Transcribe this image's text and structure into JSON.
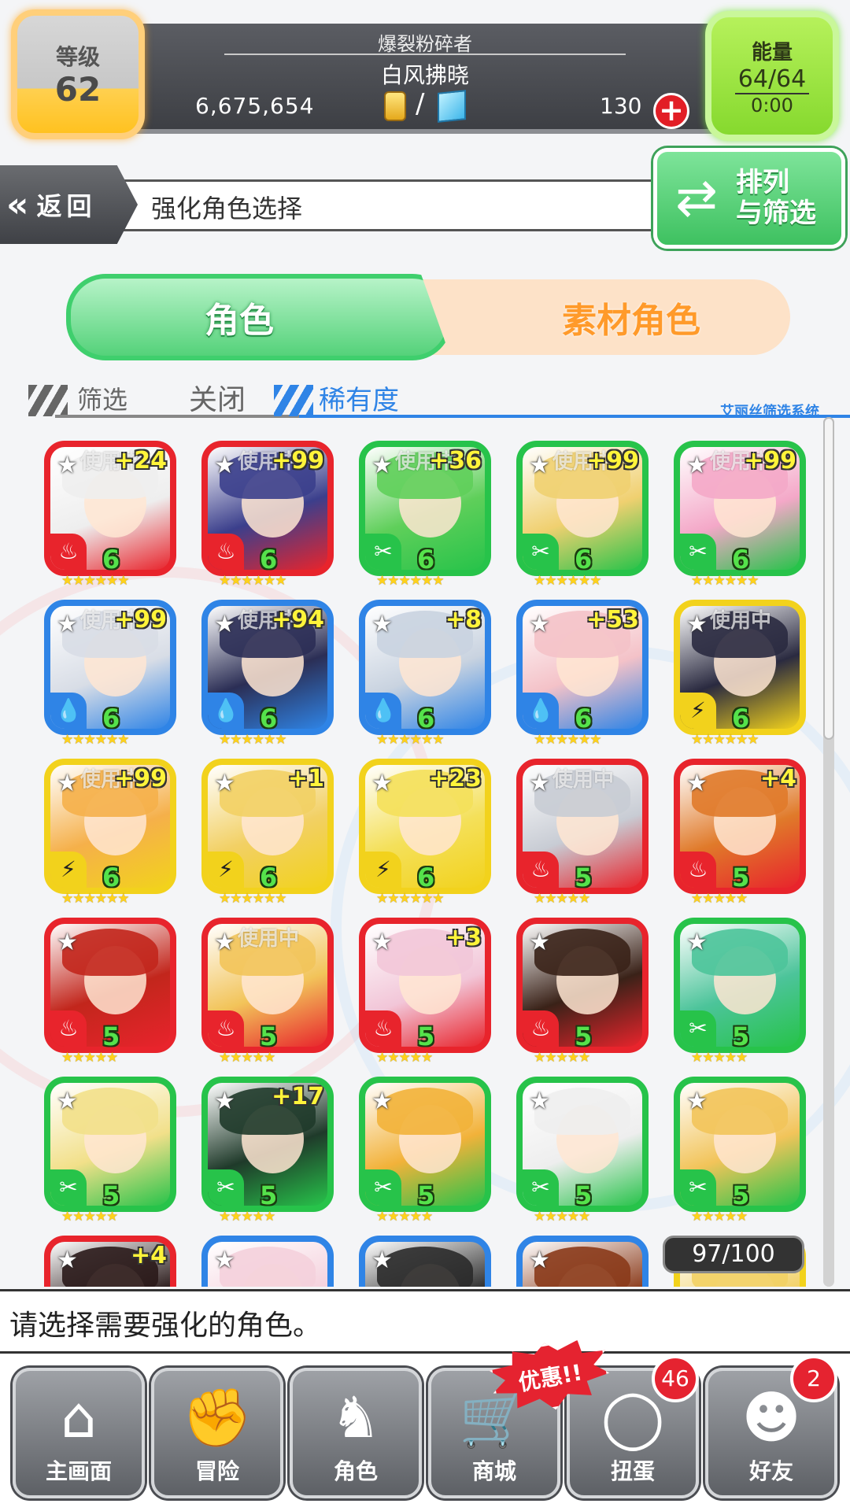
{
  "status": {
    "level_label": "等级",
    "level_value": "62",
    "player_title": "爆裂粉碎者",
    "player_name": "白风拂晓",
    "gold": "6,675,654",
    "separator": "/",
    "gems": "130",
    "energy_label": "能量",
    "energy_value": "64/64",
    "energy_timer": "0:00"
  },
  "header": {
    "back_label": "返回",
    "page_title": "强化角色选择",
    "sort_label_line1": "排列",
    "sort_label_line2": "与筛选"
  },
  "tabs": [
    {
      "label": "角色",
      "active": true
    },
    {
      "label": "素材角色",
      "active": false
    }
  ],
  "filter": {
    "filter_label": "筛选",
    "filter_value": "关闭",
    "rarity_label": "稀有度",
    "system_label": "艾丽丝筛选系统"
  },
  "colors": {
    "fire": "#e8242c",
    "water": "#2f84e6",
    "wood": "#27c34a",
    "thunder": "#f2d21c",
    "accent_green": "#3fcf6d",
    "accent_orange": "#ff9a2a"
  },
  "characters": [
    {
      "element": "fire",
      "rarity": "6",
      "plus": "+24",
      "in_use": "使用中",
      "stars": "★★★★★★",
      "hair": "#eeeeee"
    },
    {
      "element": "fire",
      "rarity": "6",
      "plus": "+99",
      "in_use": "使用中",
      "stars": "★★★★★★",
      "hair": "#3b3f8c"
    },
    {
      "element": "wood",
      "rarity": "6",
      "plus": "+36",
      "in_use": "使用中",
      "stars": "★★★★★★",
      "hair": "#5fcf5a"
    },
    {
      "element": "wood",
      "rarity": "6",
      "plus": "+99",
      "in_use": "使用中",
      "stars": "★★★★★★",
      "hair": "#f0d070"
    },
    {
      "element": "wood",
      "rarity": "6",
      "plus": "+99",
      "in_use": "使用中",
      "stars": "★★★★★★",
      "hair": "#f4a8c8"
    },
    {
      "element": "water",
      "rarity": "6",
      "plus": "+99",
      "in_use": "使用中",
      "stars": "★★★★★★",
      "hair": "#d8dde6"
    },
    {
      "element": "water",
      "rarity": "6",
      "plus": "+94",
      "in_use": "使用中",
      "stars": "★★★★★★",
      "hair": "#2b2e55"
    },
    {
      "element": "water",
      "rarity": "6",
      "plus": "+8",
      "in_use": "",
      "stars": "★★★★★★",
      "hair": "#c9d3e0"
    },
    {
      "element": "water",
      "rarity": "6",
      "plus": "+53",
      "in_use": "",
      "stars": "★★★★★★",
      "hair": "#f4c2c8"
    },
    {
      "element": "thunder",
      "rarity": "6",
      "plus": "",
      "in_use": "使用中",
      "stars": "★★★★★★",
      "hair": "#2a2a40"
    },
    {
      "element": "thunder",
      "rarity": "6",
      "plus": "+99",
      "in_use": "使用中",
      "stars": "★★★★★★",
      "hair": "#f5b04a"
    },
    {
      "element": "thunder",
      "rarity": "6",
      "plus": "+1",
      "in_use": "",
      "stars": "★★★★★★",
      "hair": "#f2d064"
    },
    {
      "element": "thunder",
      "rarity": "6",
      "plus": "+23",
      "in_use": "",
      "stars": "★★★★★★",
      "hair": "#f4e05a"
    },
    {
      "element": "fire",
      "rarity": "5",
      "plus": "",
      "in_use": "使用中",
      "stars": "★★★★★",
      "hair": "#c8ccd4"
    },
    {
      "element": "fire",
      "rarity": "5",
      "plus": "+4",
      "in_use": "",
      "stars": "★★★★★",
      "hair": "#e07a2a"
    },
    {
      "element": "fire",
      "rarity": "5",
      "plus": "",
      "in_use": "",
      "stars": "★★★★★",
      "hair": "#c2261c"
    },
    {
      "element": "fire",
      "rarity": "5",
      "plus": "",
      "in_use": "使用中",
      "stars": "★★★★★",
      "hair": "#f2c45a"
    },
    {
      "element": "fire",
      "rarity": "5",
      "plus": "+3",
      "in_use": "",
      "stars": "★★★★★",
      "hair": "#f2c6d8"
    },
    {
      "element": "fire",
      "rarity": "5",
      "plus": "",
      "in_use": "",
      "stars": "★★★★★",
      "hair": "#3a2218"
    },
    {
      "element": "wood",
      "rarity": "5",
      "plus": "",
      "in_use": "",
      "stars": "★★★★★",
      "hair": "#4cc49a"
    },
    {
      "element": "wood",
      "rarity": "5",
      "plus": "",
      "in_use": "",
      "stars": "★★★★★",
      "hair": "#f2e08a"
    },
    {
      "element": "wood",
      "rarity": "5",
      "plus": "+17",
      "in_use": "",
      "stars": "★★★★★",
      "hair": "#1f3a2a"
    },
    {
      "element": "wood",
      "rarity": "5",
      "plus": "",
      "in_use": "",
      "stars": "★★★★★",
      "hair": "#f2b23a"
    },
    {
      "element": "wood",
      "rarity": "5",
      "plus": "",
      "in_use": "",
      "stars": "★★★★★",
      "hair": "#eeeeee"
    },
    {
      "element": "wood",
      "rarity": "5",
      "plus": "",
      "in_use": "",
      "stars": "★★★★★",
      "hair": "#f2c45a"
    },
    {
      "element": "fire",
      "rarity": "",
      "plus": "+4",
      "in_use": "",
      "stars": "",
      "hair": "#2a1a1a"
    },
    {
      "element": "water",
      "rarity": "",
      "plus": "",
      "in_use": "",
      "stars": "",
      "hair": "#f4d0dc"
    },
    {
      "element": "water",
      "rarity": "",
      "plus": "",
      "in_use": "",
      "stars": "",
      "hair": "#2a2a2a"
    },
    {
      "element": "water",
      "rarity": "",
      "plus": "",
      "in_use": "",
      "stars": "",
      "hair": "#8a3a1a"
    },
    {
      "element": "thunder",
      "rarity": "",
      "plus": "",
      "in_use": "",
      "stars": "",
      "hair": "#f2d064"
    }
  ],
  "box_count": "97/100",
  "message": "请选择需要强化的角色。",
  "nav": [
    {
      "label": "主画面",
      "icon": "home-icon",
      "badge": ""
    },
    {
      "label": "冒险",
      "icon": "handshake-icon",
      "badge": ""
    },
    {
      "label": "角色",
      "icon": "bunny-icon",
      "badge": ""
    },
    {
      "label": "商城",
      "icon": "cart-icon",
      "badge": ""
    },
    {
      "label": "扭蛋",
      "icon": "egg-icon",
      "badge": "46"
    },
    {
      "label": "好友",
      "icon": "friends-icon",
      "badge": "2"
    }
  ],
  "promo_label": "优惠!!"
}
